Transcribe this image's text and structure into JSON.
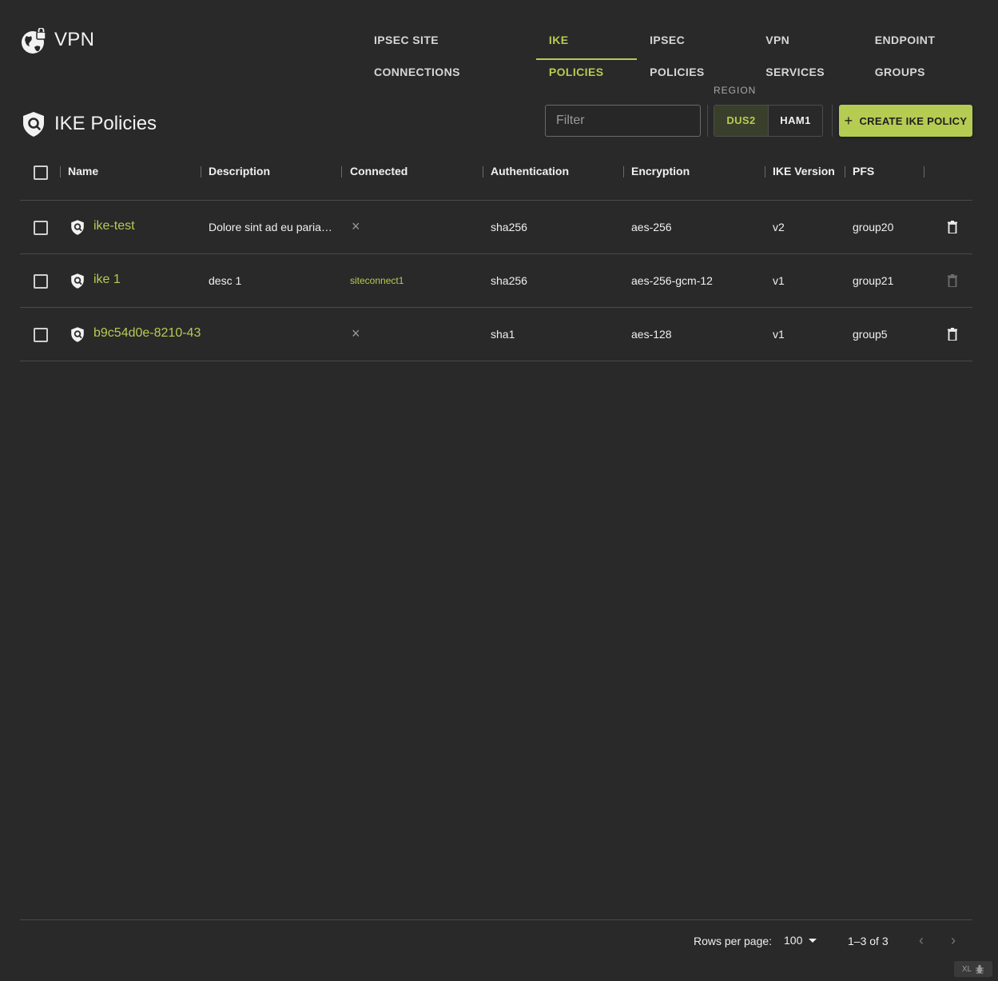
{
  "app": {
    "title": "VPN"
  },
  "nav": {
    "tabs": [
      {
        "label": "IPSEC SITE CONNECTIONS",
        "active": false
      },
      {
        "label": "IKE POLICIES",
        "active": true
      },
      {
        "label": "IPSEC POLICIES",
        "active": false
      },
      {
        "label": "VPN SERVICES",
        "active": false
      },
      {
        "label": "ENDPOINT GROUPS",
        "active": false
      }
    ]
  },
  "page": {
    "title": "IKE Policies"
  },
  "toolbar": {
    "filter_placeholder": "Filter",
    "filter_value": "",
    "region_label": "REGION",
    "regions": [
      {
        "label": "DUS2",
        "active": true
      },
      {
        "label": "HAM1",
        "active": false
      }
    ],
    "create_label": "CREATE IKE POLICY"
  },
  "table": {
    "headers": [
      "Name",
      "Description",
      "Connected",
      "Authentication",
      "Encryption",
      "IKE Version",
      "PFS"
    ],
    "rows": [
      {
        "name": "ike-test",
        "description": "Dolore sint ad eu paria…",
        "connected": "×",
        "authentication": "sha256",
        "encryption": "aes-256",
        "ike_version": "v2",
        "pfs": "group20",
        "delete_enabled": true
      },
      {
        "name": "ike 1",
        "description": "desc 1",
        "connected": "siteconnect1",
        "authentication": "sha256",
        "encryption": "aes-256-gcm-12",
        "ike_version": "v1",
        "pfs": "group21",
        "delete_enabled": false
      },
      {
        "name": "b9c54d0e-8210-43",
        "description": "",
        "connected": "×",
        "authentication": "sha1",
        "encryption": "aes-128",
        "ike_version": "v1",
        "pfs": "group5",
        "delete_enabled": true
      }
    ]
  },
  "footer": {
    "rows_per_page_label": "Rows per page:",
    "rows_per_page_value": "100",
    "range": "1–3 of 3",
    "prev": "‹",
    "next": "›"
  },
  "badge": {
    "label": "XL"
  },
  "colors": {
    "accent": "#b5cc52",
    "background": "#292929"
  }
}
